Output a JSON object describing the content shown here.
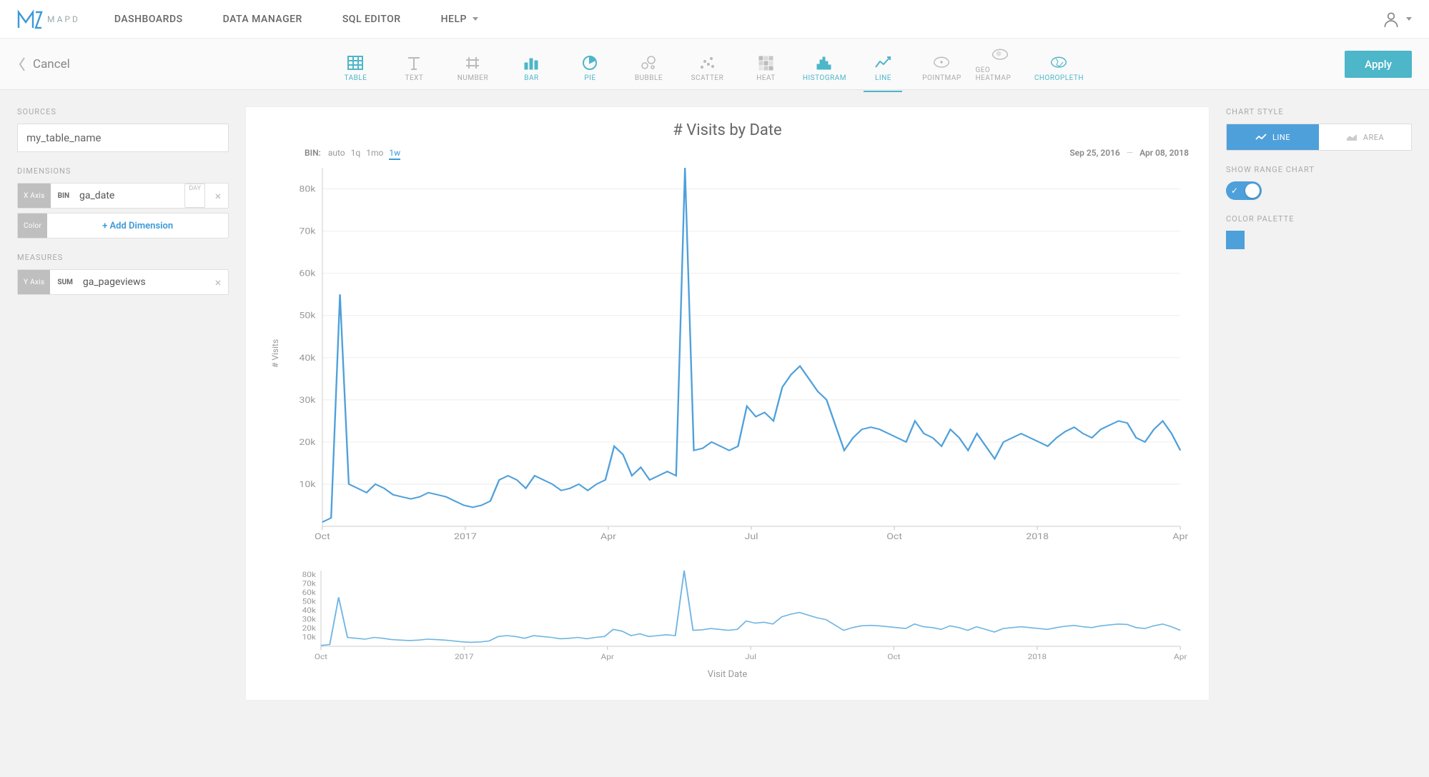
{
  "brand": "MAPD",
  "nav": {
    "dashboards": "DASHBOARDS",
    "data_manager": "DATA MANAGER",
    "sql_editor": "SQL EDITOR",
    "help": "HELP"
  },
  "subbar": {
    "cancel": "Cancel",
    "apply": "Apply",
    "types": [
      "TABLE",
      "TEXT",
      "NUMBER",
      "BAR",
      "PIE",
      "BUBBLE",
      "SCATTER",
      "HEAT",
      "HISTOGRAM",
      "LINE",
      "POINTMAP",
      "GEO HEATMAP",
      "CHOROPLETH"
    ]
  },
  "left": {
    "sources_label": "SOURCES",
    "source_value": "my_table_name",
    "dimensions_label": "DIMENSIONS",
    "xaxis_tag": "X Axis",
    "bin": "BIN",
    "dim_field": "ga_date",
    "dim_badge": "DAY",
    "color_tag": "Color",
    "add_dim": "+ Add Dimension",
    "measures_label": "MEASURES",
    "yaxis_tag": "Y Axis",
    "sum": "SUM",
    "meas_field": "ga_pageviews"
  },
  "right": {
    "style_label": "CHART STYLE",
    "line": "LINE",
    "area": "AREA",
    "range_label": "SHOW RANGE CHART",
    "palette_label": "COLOR PALETTE"
  },
  "chart": {
    "title": "# Visits by Date",
    "bin_label": "BIN:",
    "bin_opts": [
      "auto",
      "1q",
      "1mo",
      "1w"
    ],
    "bin_active": "1w",
    "date_from": "Sep 25, 2016",
    "date_to": "Apr 08, 2018",
    "ylabel": "# Visits",
    "xlabel": "Visit Date"
  },
  "chart_data": {
    "type": "line",
    "title": "# Visits by Date",
    "xlabel": "Visit Date",
    "ylabel": "# Visits",
    "ylim": [
      0,
      85000
    ],
    "x_range": [
      "2016-09-25",
      "2018-04-08"
    ],
    "x_ticks": [
      "Oct",
      "2017",
      "Apr",
      "Jul",
      "Oct",
      "2018",
      "Apr"
    ],
    "y_ticks": [
      10000,
      20000,
      30000,
      40000,
      50000,
      60000,
      70000,
      80000
    ],
    "y_tick_labels": [
      "10k",
      "20k",
      "30k",
      "40k",
      "50k",
      "60k",
      "70k",
      "80k"
    ],
    "series": [
      {
        "name": "Visits",
        "color": "#4ea0db",
        "values": [
          1000,
          2000,
          55000,
          10000,
          9000,
          8000,
          10000,
          9000,
          7500,
          7000,
          6500,
          7000,
          8000,
          7500,
          7000,
          6000,
          5000,
          4500,
          5000,
          6000,
          11000,
          12000,
          11000,
          9000,
          12000,
          11000,
          10000,
          8500,
          9000,
          10000,
          8500,
          10000,
          11000,
          19000,
          17000,
          12000,
          14000,
          11000,
          12000,
          13000,
          12000,
          85000,
          18000,
          18500,
          20000,
          19000,
          18000,
          19000,
          28500,
          26000,
          27000,
          25000,
          33000,
          36000,
          38000,
          35000,
          32000,
          30000,
          24000,
          18000,
          21000,
          23000,
          23500,
          23000,
          22000,
          21000,
          20000,
          25000,
          22000,
          21000,
          19000,
          23000,
          21000,
          18000,
          22000,
          19000,
          16000,
          20000,
          21000,
          22000,
          21000,
          20000,
          19000,
          21000,
          22500,
          23500,
          22000,
          21000,
          23000,
          24000,
          25000,
          24500,
          21000,
          20000,
          23000,
          25000,
          22000,
          18000
        ]
      }
    ]
  }
}
